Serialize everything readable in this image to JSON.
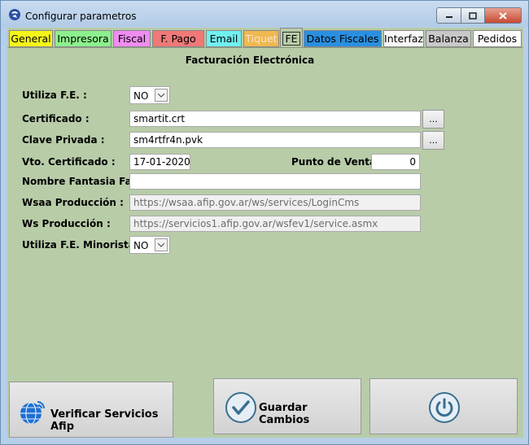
{
  "window": {
    "title": "Configurar parametros"
  },
  "tabs": [
    {
      "label": "General",
      "color": "#f5f51a",
      "fg": "#000000"
    },
    {
      "label": "Impresora",
      "color": "#8cf08c",
      "fg": "#000000"
    },
    {
      "label": "Fiscal",
      "color": "#f08cf0",
      "fg": "#000000"
    },
    {
      "label": "F. Pago",
      "color": "#f07878",
      "fg": "#000000"
    },
    {
      "label": "Email",
      "color": "#70f0f0",
      "fg": "#000000"
    },
    {
      "label": "Tiquet",
      "color": "#f0b850",
      "fg": "#f6e5cc"
    },
    {
      "label": "FE",
      "color": "#b8cca8",
      "fg": "#000000"
    },
    {
      "label": "Datos Fiscales",
      "color": "#2a8fe0",
      "fg": "#000000"
    },
    {
      "label": "Interfaz",
      "color": "#f8f8f8",
      "fg": "#000000"
    },
    {
      "label": "Balanza",
      "color": "#c8c8c8",
      "fg": "#000000"
    },
    {
      "label": "Pedidos",
      "color": "#fdfdfd",
      "fg": "#000000"
    }
  ],
  "form": {
    "heading": "Facturación Electrónica",
    "utiliza_fe": {
      "label": "Utiliza F.E. :",
      "value": "NO"
    },
    "certificado": {
      "label": "Certificado :",
      "value": "smartit.crt",
      "browse": "..."
    },
    "clave_privada": {
      "label": "Clave Privada :",
      "value": "sm4rtfr4n.pvk",
      "browse": "..."
    },
    "vto_certificado": {
      "label": "Vto. Certificado :",
      "value": "17-01-2020"
    },
    "punto_venta": {
      "label": "Punto de Venta :",
      "value": "0"
    },
    "nombre_fantasia": {
      "label": "Nombre Fantasia Fact.:",
      "value": ""
    },
    "wsaa": {
      "label": "Wsaa Producción :",
      "value": "https://wsaa.afip.gov.ar/ws/services/LoginCms"
    },
    "ws": {
      "label": "Ws Producción :",
      "value": "https://servicios1.afip.gov.ar/wsfev1/service.asmx"
    },
    "minorista": {
      "label": "Utiliza F.E. Minorista :",
      "value": "NO"
    }
  },
  "buttons": {
    "verificar": "Verificar Servicios Afip",
    "guardar": "Guardar Cambios"
  }
}
